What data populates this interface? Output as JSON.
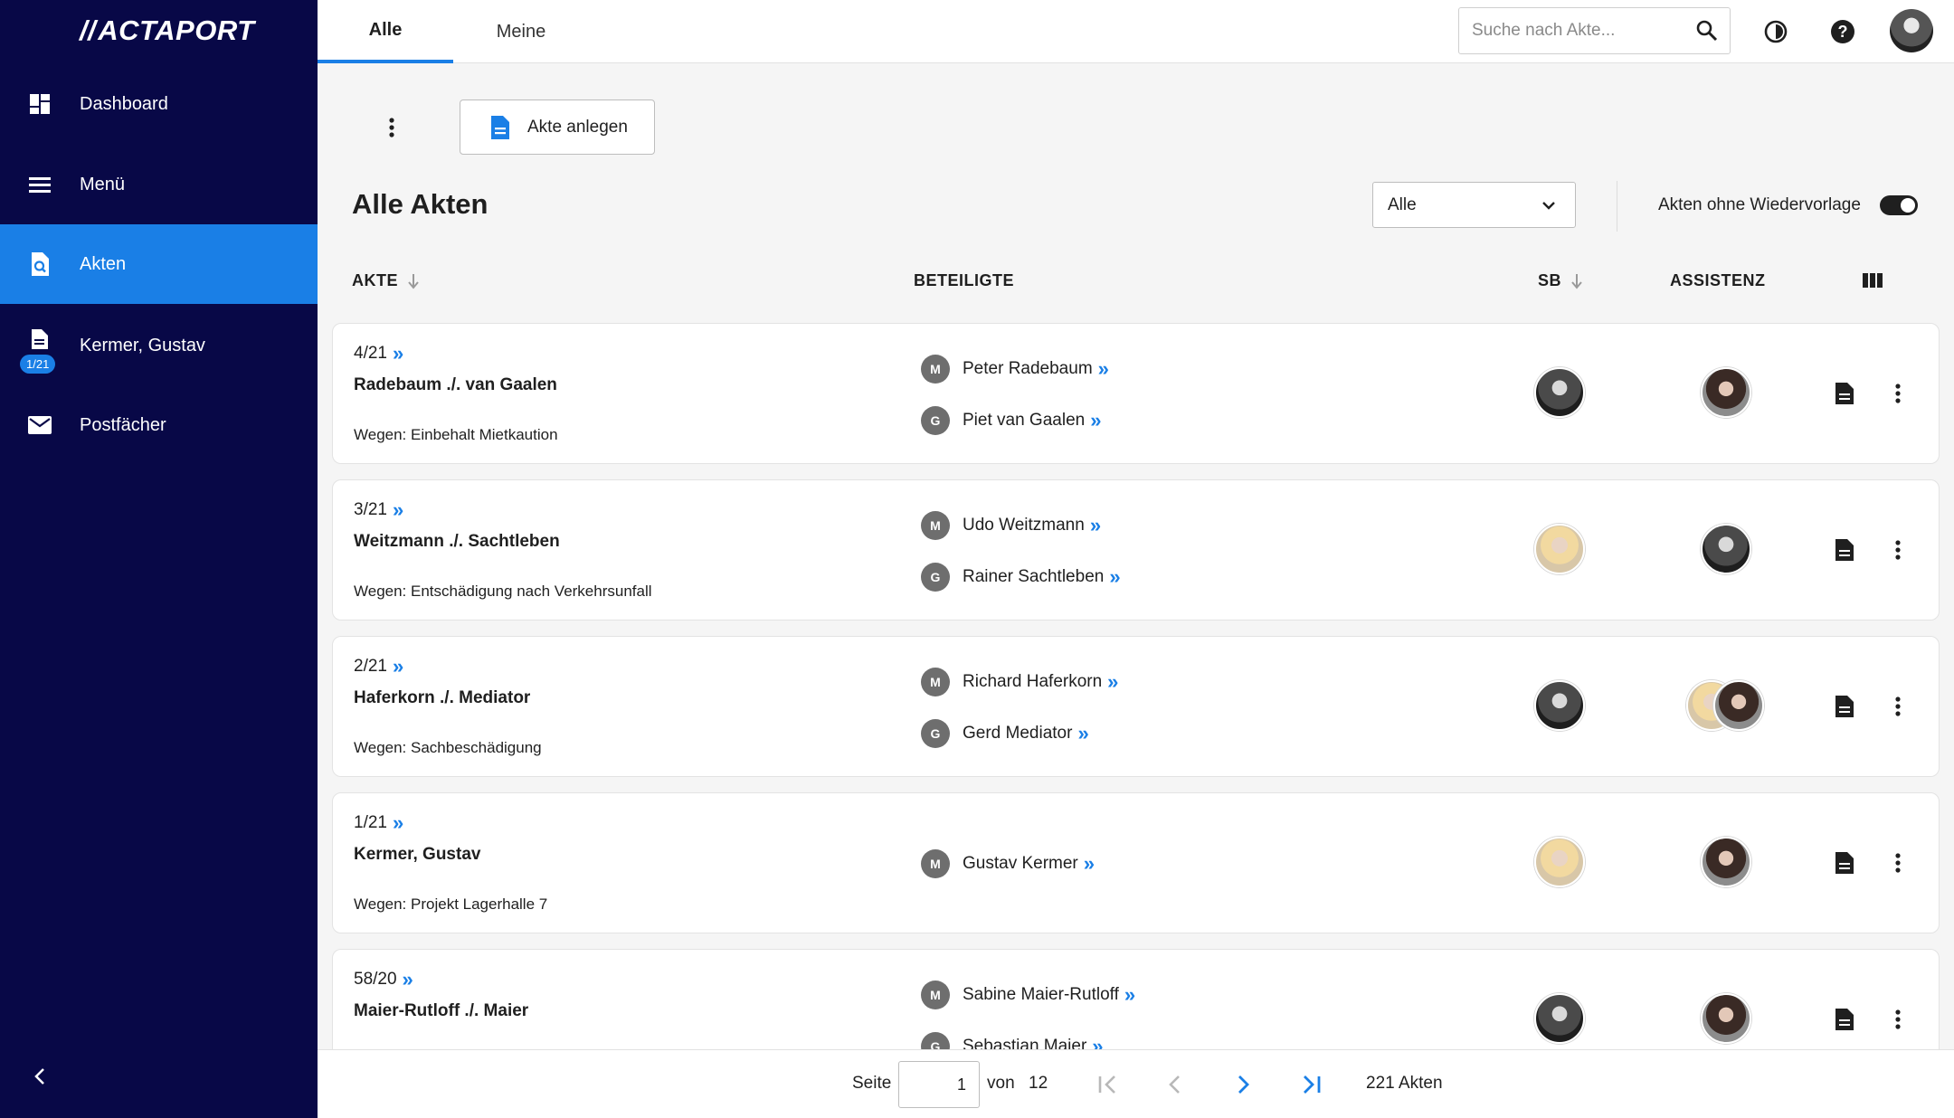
{
  "sidebar": {
    "logo": "ACTAPORT",
    "items": [
      {
        "label": "Dashboard",
        "icon": "dashboard-icon"
      },
      {
        "label": "Menü",
        "icon": "menu-icon"
      },
      {
        "label": "Akten",
        "icon": "akten-search-icon",
        "active": true
      },
      {
        "label": "Kermer, Gustav",
        "icon": "document-icon",
        "badge": "1/21"
      },
      {
        "label": "Postfächer",
        "icon": "mail-icon"
      }
    ]
  },
  "topbar": {
    "tabs": [
      {
        "label": "Alle",
        "active": true
      },
      {
        "label": "Meine"
      }
    ],
    "search_placeholder": "Suche nach Akte..."
  },
  "toolbar": {
    "create_label": "Akte anlegen"
  },
  "main": {
    "title": "Alle Akten",
    "filter_value": "Alle",
    "toggle_label": "Akten ohne Wiedervorlage",
    "toggle_on": true
  },
  "table": {
    "headers": {
      "akte": "AKTE",
      "beteiligte": "BETEILIGTE",
      "sb": "SB",
      "assistenz": "ASSISTENZ"
    },
    "rows": [
      {
        "num": "4/21",
        "name": "Radebaum ./. van Gaalen",
        "wegen": "Wegen: Einbehalt Mietkaution",
        "parties": [
          {
            "role": "M",
            "name": "Peter Radebaum"
          },
          {
            "role": "G",
            "name": "Piet van Gaalen"
          }
        ]
      },
      {
        "num": "3/21",
        "name": "Weitzmann ./. Sachtleben",
        "wegen": "Wegen: Entschädigung nach Verkehrsunfall",
        "parties": [
          {
            "role": "M",
            "name": "Udo Weitzmann"
          },
          {
            "role": "G",
            "name": "Rainer Sachtleben"
          }
        ]
      },
      {
        "num": "2/21",
        "name": "Haferkorn ./. Mediator",
        "wegen": "Wegen: Sachbeschädigung",
        "parties": [
          {
            "role": "M",
            "name": "Richard Haferkorn"
          },
          {
            "role": "G",
            "name": "Gerd Mediator"
          }
        ]
      },
      {
        "num": "1/21",
        "name": "Kermer, Gustav",
        "wegen": "Wegen: Projekt Lagerhalle 7",
        "parties": [
          {
            "role": "M",
            "name": "Gustav Kermer"
          }
        ]
      },
      {
        "num": "58/20",
        "name": "Maier-Rutloff ./. Maier",
        "wegen": "",
        "parties": [
          {
            "role": "M",
            "name": "Sabine Maier-Rutloff"
          },
          {
            "role": "G",
            "name": "Sebastian Maier"
          }
        ]
      }
    ]
  },
  "pager": {
    "seite_label": "Seite",
    "page": "1",
    "von_label": "von",
    "total_pages": "12",
    "total_label": "221 Akten"
  },
  "colors": {
    "sidebar_bg": "#080847",
    "accent": "#1a7fe6"
  }
}
